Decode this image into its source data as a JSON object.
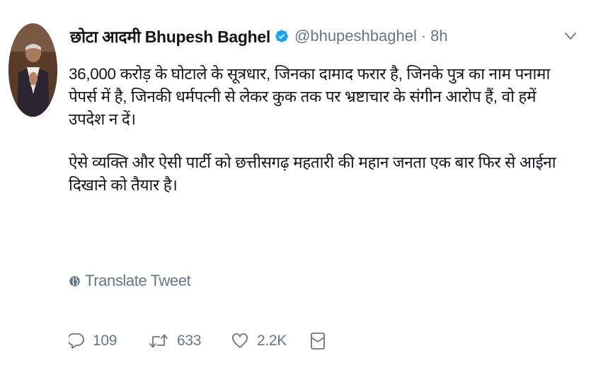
{
  "tweet": {
    "display_name": "छोटा आदमी Bhupesh Baghel",
    "handle": "@bhupeshbaghel",
    "separator": "·",
    "time": "8h",
    "paragraphs": [
      "36,000 करोड़ के घोटाले के सूत्रधार, जिनका दामाद फरार है, जिनके पुत्र का नाम पनामा पेपर्स में है, जिनकी धर्मपत्नी से लेकर कुक तक पर भ्रष्टाचार के संगीन आरोप हैं, वो हमें उपदेश न दें।",
      "ऐसे व्यक्ति और ऐसी पार्टी को छत्तीसगढ़ महतारी की महान जनता एक बार फिर से आईना दिखाने को तैयार है।"
    ],
    "translate_label": "Translate Tweet",
    "actions": {
      "reply_count": "109",
      "retweet_count": "633",
      "like_count": "2.2K"
    },
    "icons": {
      "verified": "verified-badge-icon",
      "caret": "chevron-down-icon",
      "globe": "globe-icon",
      "reply": "reply-icon",
      "retweet": "retweet-icon",
      "like": "heart-icon",
      "dm": "direct-message-icon"
    },
    "colors": {
      "verified_blue": "#1da1f2",
      "secondary_text": "#657786",
      "primary_text": "#14171a"
    }
  }
}
